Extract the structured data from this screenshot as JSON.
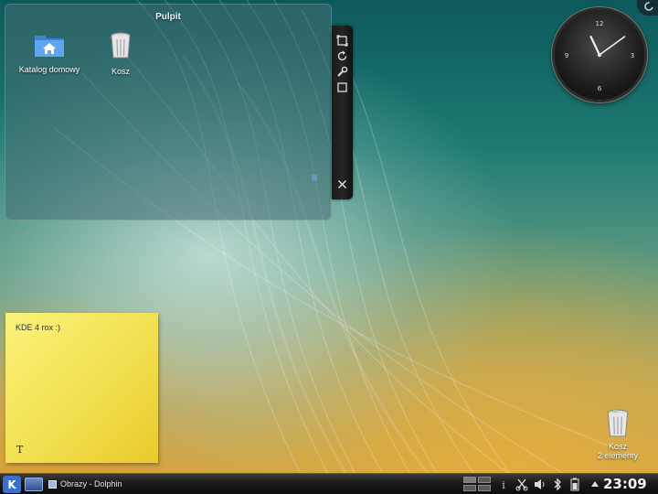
{
  "folder_view": {
    "title": "Pulpit",
    "icons": [
      {
        "label": "Katalog domowy",
        "icon": "home-folder-icon"
      },
      {
        "label": "Kosz",
        "icon": "trash-icon"
      }
    ]
  },
  "applet_handle": {
    "buttons": [
      "resize-icon",
      "rotate-icon",
      "wrench-icon",
      "maximize-icon",
      "close-icon"
    ]
  },
  "clock": {
    "hour": 23,
    "minute": 9,
    "numerals": [
      "12",
      "3",
      "6",
      "9"
    ]
  },
  "sticky_note": {
    "text": "KDE 4 rox :)",
    "format_glyph": "T"
  },
  "desktop_trash": {
    "label": "Kosz",
    "sublabel": "2 elementy"
  },
  "taskbar": {
    "task_label": "Obrazy - Dolphin",
    "time": "23:09",
    "tray_icons": [
      "info-icon",
      "scissors-icon",
      "volume-icon",
      "bluetooth-icon",
      "battery-icon",
      "up-arrow-icon"
    ]
  },
  "colors": {
    "note_yellow": "#f2e050",
    "folder_blue": "#5b9be0",
    "panel_dark": "#1b1b1b"
  }
}
